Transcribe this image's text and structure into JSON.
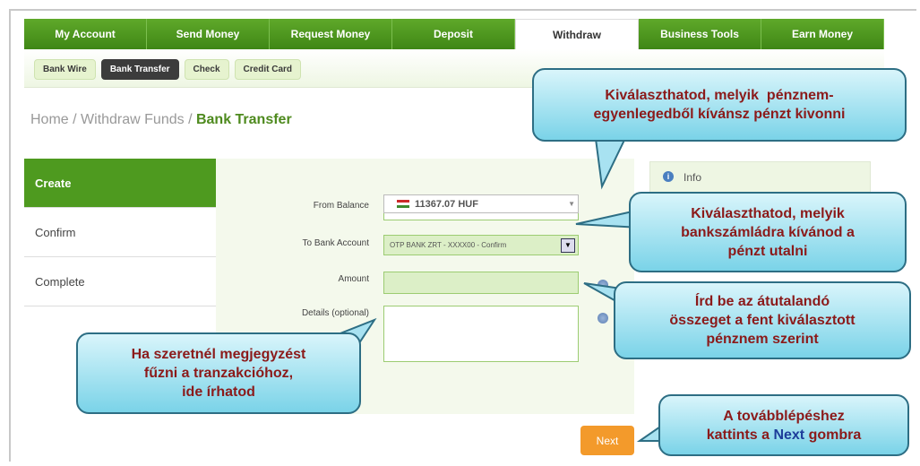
{
  "topnav": [
    "My Account",
    "Send Money",
    "Request Money",
    "Deposit",
    "Withdraw",
    "Business Tools",
    "Earn Money"
  ],
  "subnav": [
    "Bank Wire",
    "Bank Transfer",
    "Check",
    "Credit Card"
  ],
  "breadcrumb": {
    "home": "Home",
    "sep1": " / ",
    "withdraw": "Withdraw Funds",
    "sep2": " / ",
    "current": "Bank Transfer"
  },
  "steps": [
    "Create",
    "Confirm",
    "Complete"
  ],
  "form": {
    "from_label": "From Balance",
    "from_value": "11367.07 HUF",
    "to_label": "To Bank Account",
    "to_value": "OTP BANK ZRT - XXXX00 - Confirm",
    "amount_label": "Amount",
    "amount_value": "",
    "details_label": "Details (optional)",
    "details_value": ""
  },
  "info": {
    "title": "Info"
  },
  "next_button": "Next",
  "callouts": {
    "c1": [
      "Kiválaszthatod, melyik  pénznem-",
      "egyenlegedből kívánsz pénzt kivonni"
    ],
    "c2": [
      "Kiválaszthatod, melyik",
      "bankszámládra kívánod a",
      "pénzt utalni"
    ],
    "c3": [
      "Írd be az átutalandó",
      "összeget a fent kiválasztott",
      "pénznem szerint"
    ],
    "c4": [
      "Ha szeretnél megjegyzést",
      "fűzni a tranzakcióhoz,",
      "ide írhatod"
    ],
    "c5a": "A továbblépéshez",
    "c5b_pre": "kattints a ",
    "c5b_next": "Next",
    "c5b_post": " gombra"
  },
  "colors": {
    "nav_green": "#4e9a1f",
    "next_orange": "#f39a2b",
    "callout_border": "#2d6e84",
    "callout_text": "#8b1a1a"
  }
}
